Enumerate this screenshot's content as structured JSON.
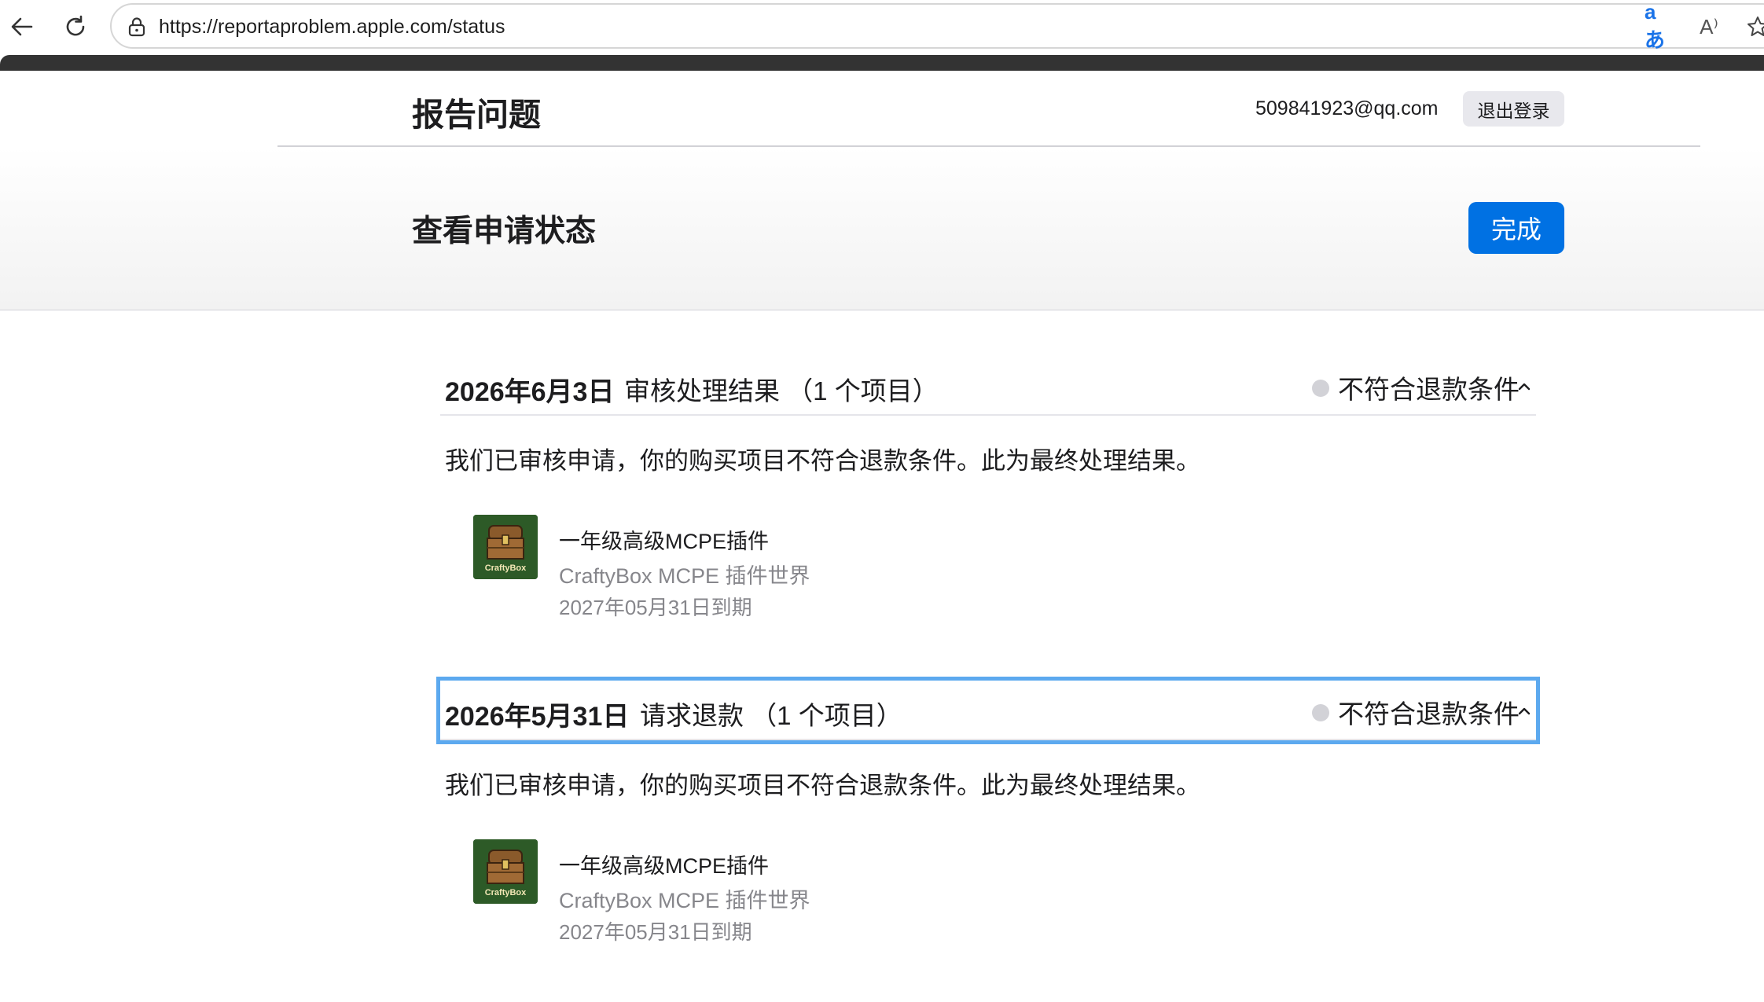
{
  "browser": {
    "url": "https://reportaproblem.apple.com/status",
    "translate_glyph": "aあ",
    "read_aloud_glyph": "A⁾"
  },
  "header": {
    "title": "报告问题",
    "email": "509841923@qq.com",
    "sign_out_label": "退出登录"
  },
  "status_band": {
    "title": "查看申请状态",
    "done_label": "完成"
  },
  "requests": [
    {
      "date": "2026年6月3日",
      "type": "审核处理结果 （1 个项目）",
      "status": "不符合退款条件",
      "message": "我们已审核申请，你的购买项目不符合退款条件。此为最终处理结果。",
      "item": {
        "icon_label": "CraftyBox",
        "name": "一年级高级MCPE插件",
        "developer": "CraftyBox MCPE 插件世界",
        "expiry": "2027年05月31日到期"
      }
    },
    {
      "date": "2026年5月31日",
      "type": "请求退款 （1 个项目）",
      "status": "不符合退款条件",
      "message": "我们已审核申请，你的购买项目不符合退款条件。此为最终处理结果。",
      "item": {
        "icon_label": "CraftyBox",
        "name": "一年级高级MCPE插件",
        "developer": "CraftyBox MCPE 插件世界",
        "expiry": "2027年05月31日到期"
      }
    }
  ],
  "colors": {
    "accent": "#0071e3",
    "focus_ring": "#5ca9ef",
    "status_dot": "#d2d2d7",
    "secondary_text": "#86868b"
  }
}
